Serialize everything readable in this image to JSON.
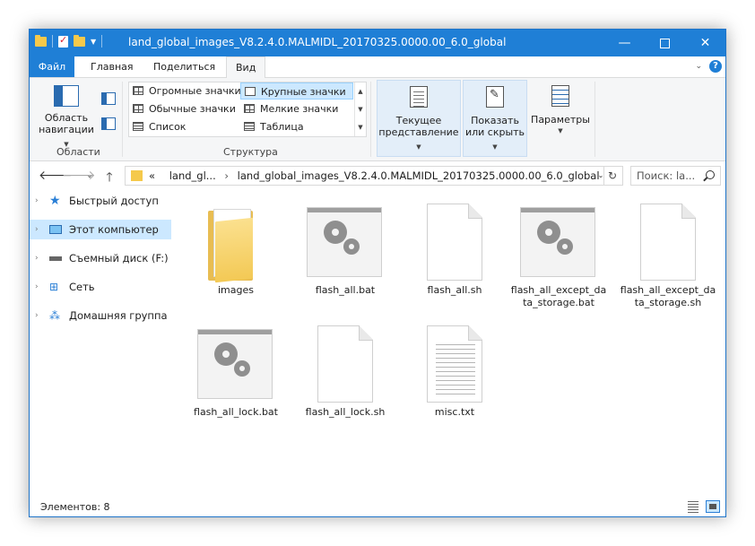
{
  "window": {
    "title": "land_global_images_V8.2.4.0.MALMIDL_20170325.0000.00_6.0_global"
  },
  "ribbon_tabs": {
    "file": "Файл",
    "home": "Главная",
    "share": "Поделиться",
    "view": "Вид"
  },
  "ribbon": {
    "nav_pane_label_1": "Область",
    "nav_pane_label_2": "навигации",
    "group_panes": "Области",
    "group_layout": "Структура",
    "layout_options": [
      "Огромные значки",
      "Крупные значки",
      "Обычные значки",
      "Мелкие значки",
      "Список",
      "Таблица"
    ],
    "layout_selected": "Крупные значки",
    "current_view_1": "Текущее",
    "current_view_2": "представление",
    "show_hide_1": "Показать",
    "show_hide_2": "или скрыть",
    "options": "Параметры"
  },
  "address": {
    "prefix": "«",
    "crumb1": "land_gl...",
    "crumb2": "land_global_images_V8.2.4.0.MALMIDL_20170325.0000.00_6.0_global",
    "search_placeholder": "Поиск: la..."
  },
  "nav_pane": {
    "items": [
      {
        "label": "Быстрый доступ",
        "icon": "star-icon"
      },
      {
        "label": "Этот компьютер",
        "icon": "computer-icon",
        "selected": true
      },
      {
        "label": "Съемный диск (F:)",
        "icon": "drive-icon"
      },
      {
        "label": "Сеть",
        "icon": "network-icon"
      },
      {
        "label": "Домашняя группа",
        "icon": "homegroup-icon"
      }
    ]
  },
  "files": [
    {
      "name": "images",
      "type": "folder"
    },
    {
      "name": "flash_all.bat",
      "type": "bat"
    },
    {
      "name": "flash_all.sh",
      "type": "doc"
    },
    {
      "name": "flash_all_except_data_storage.bat",
      "type": "bat"
    },
    {
      "name": "flash_all_except_data_storage.sh",
      "type": "doc"
    },
    {
      "name": "flash_all_lock.bat",
      "type": "bat"
    },
    {
      "name": "flash_all_lock.sh",
      "type": "doc"
    },
    {
      "name": "misc.txt",
      "type": "txt"
    }
  ],
  "status": {
    "items_count": "Элементов: 8"
  },
  "colors": {
    "accent": "#1f7fd6",
    "selection": "#cce8ff",
    "folder": "#f5c94b"
  }
}
